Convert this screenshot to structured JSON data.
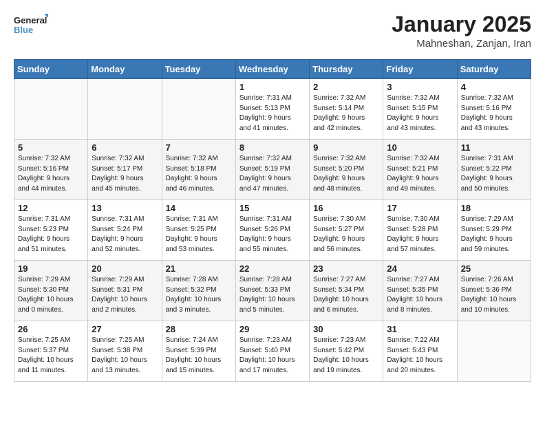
{
  "header": {
    "logo_line1": "General",
    "logo_line2": "Blue",
    "month": "January 2025",
    "location": "Mahneshan, Zanjan, Iran"
  },
  "weekdays": [
    "Sunday",
    "Monday",
    "Tuesday",
    "Wednesday",
    "Thursday",
    "Friday",
    "Saturday"
  ],
  "weeks": [
    [
      {
        "day": "",
        "info": ""
      },
      {
        "day": "",
        "info": ""
      },
      {
        "day": "",
        "info": ""
      },
      {
        "day": "1",
        "info": "Sunrise: 7:31 AM\nSunset: 5:13 PM\nDaylight: 9 hours\nand 41 minutes."
      },
      {
        "day": "2",
        "info": "Sunrise: 7:32 AM\nSunset: 5:14 PM\nDaylight: 9 hours\nand 42 minutes."
      },
      {
        "day": "3",
        "info": "Sunrise: 7:32 AM\nSunset: 5:15 PM\nDaylight: 9 hours\nand 43 minutes."
      },
      {
        "day": "4",
        "info": "Sunrise: 7:32 AM\nSunset: 5:16 PM\nDaylight: 9 hours\nand 43 minutes."
      }
    ],
    [
      {
        "day": "5",
        "info": "Sunrise: 7:32 AM\nSunset: 5:16 PM\nDaylight: 9 hours\nand 44 minutes."
      },
      {
        "day": "6",
        "info": "Sunrise: 7:32 AM\nSunset: 5:17 PM\nDaylight: 9 hours\nand 45 minutes."
      },
      {
        "day": "7",
        "info": "Sunrise: 7:32 AM\nSunset: 5:18 PM\nDaylight: 9 hours\nand 46 minutes."
      },
      {
        "day": "8",
        "info": "Sunrise: 7:32 AM\nSunset: 5:19 PM\nDaylight: 9 hours\nand 47 minutes."
      },
      {
        "day": "9",
        "info": "Sunrise: 7:32 AM\nSunset: 5:20 PM\nDaylight: 9 hours\nand 48 minutes."
      },
      {
        "day": "10",
        "info": "Sunrise: 7:32 AM\nSunset: 5:21 PM\nDaylight: 9 hours\nand 49 minutes."
      },
      {
        "day": "11",
        "info": "Sunrise: 7:31 AM\nSunset: 5:22 PM\nDaylight: 9 hours\nand 50 minutes."
      }
    ],
    [
      {
        "day": "12",
        "info": "Sunrise: 7:31 AM\nSunset: 5:23 PM\nDaylight: 9 hours\nand 51 minutes."
      },
      {
        "day": "13",
        "info": "Sunrise: 7:31 AM\nSunset: 5:24 PM\nDaylight: 9 hours\nand 52 minutes."
      },
      {
        "day": "14",
        "info": "Sunrise: 7:31 AM\nSunset: 5:25 PM\nDaylight: 9 hours\nand 53 minutes."
      },
      {
        "day": "15",
        "info": "Sunrise: 7:31 AM\nSunset: 5:26 PM\nDaylight: 9 hours\nand 55 minutes."
      },
      {
        "day": "16",
        "info": "Sunrise: 7:30 AM\nSunset: 5:27 PM\nDaylight: 9 hours\nand 56 minutes."
      },
      {
        "day": "17",
        "info": "Sunrise: 7:30 AM\nSunset: 5:28 PM\nDaylight: 9 hours\nand 57 minutes."
      },
      {
        "day": "18",
        "info": "Sunrise: 7:29 AM\nSunset: 5:29 PM\nDaylight: 9 hours\nand 59 minutes."
      }
    ],
    [
      {
        "day": "19",
        "info": "Sunrise: 7:29 AM\nSunset: 5:30 PM\nDaylight: 10 hours\nand 0 minutes."
      },
      {
        "day": "20",
        "info": "Sunrise: 7:29 AM\nSunset: 5:31 PM\nDaylight: 10 hours\nand 2 minutes."
      },
      {
        "day": "21",
        "info": "Sunrise: 7:28 AM\nSunset: 5:32 PM\nDaylight: 10 hours\nand 3 minutes."
      },
      {
        "day": "22",
        "info": "Sunrise: 7:28 AM\nSunset: 5:33 PM\nDaylight: 10 hours\nand 5 minutes."
      },
      {
        "day": "23",
        "info": "Sunrise: 7:27 AM\nSunset: 5:34 PM\nDaylight: 10 hours\nand 6 minutes."
      },
      {
        "day": "24",
        "info": "Sunrise: 7:27 AM\nSunset: 5:35 PM\nDaylight: 10 hours\nand 8 minutes."
      },
      {
        "day": "25",
        "info": "Sunrise: 7:26 AM\nSunset: 5:36 PM\nDaylight: 10 hours\nand 10 minutes."
      }
    ],
    [
      {
        "day": "26",
        "info": "Sunrise: 7:25 AM\nSunset: 5:37 PM\nDaylight: 10 hours\nand 11 minutes."
      },
      {
        "day": "27",
        "info": "Sunrise: 7:25 AM\nSunset: 5:38 PM\nDaylight: 10 hours\nand 13 minutes."
      },
      {
        "day": "28",
        "info": "Sunrise: 7:24 AM\nSunset: 5:39 PM\nDaylight: 10 hours\nand 15 minutes."
      },
      {
        "day": "29",
        "info": "Sunrise: 7:23 AM\nSunset: 5:40 PM\nDaylight: 10 hours\nand 17 minutes."
      },
      {
        "day": "30",
        "info": "Sunrise: 7:23 AM\nSunset: 5:42 PM\nDaylight: 10 hours\nand 19 minutes."
      },
      {
        "day": "31",
        "info": "Sunrise: 7:22 AM\nSunset: 5:43 PM\nDaylight: 10 hours\nand 20 minutes."
      },
      {
        "day": "",
        "info": ""
      }
    ]
  ]
}
